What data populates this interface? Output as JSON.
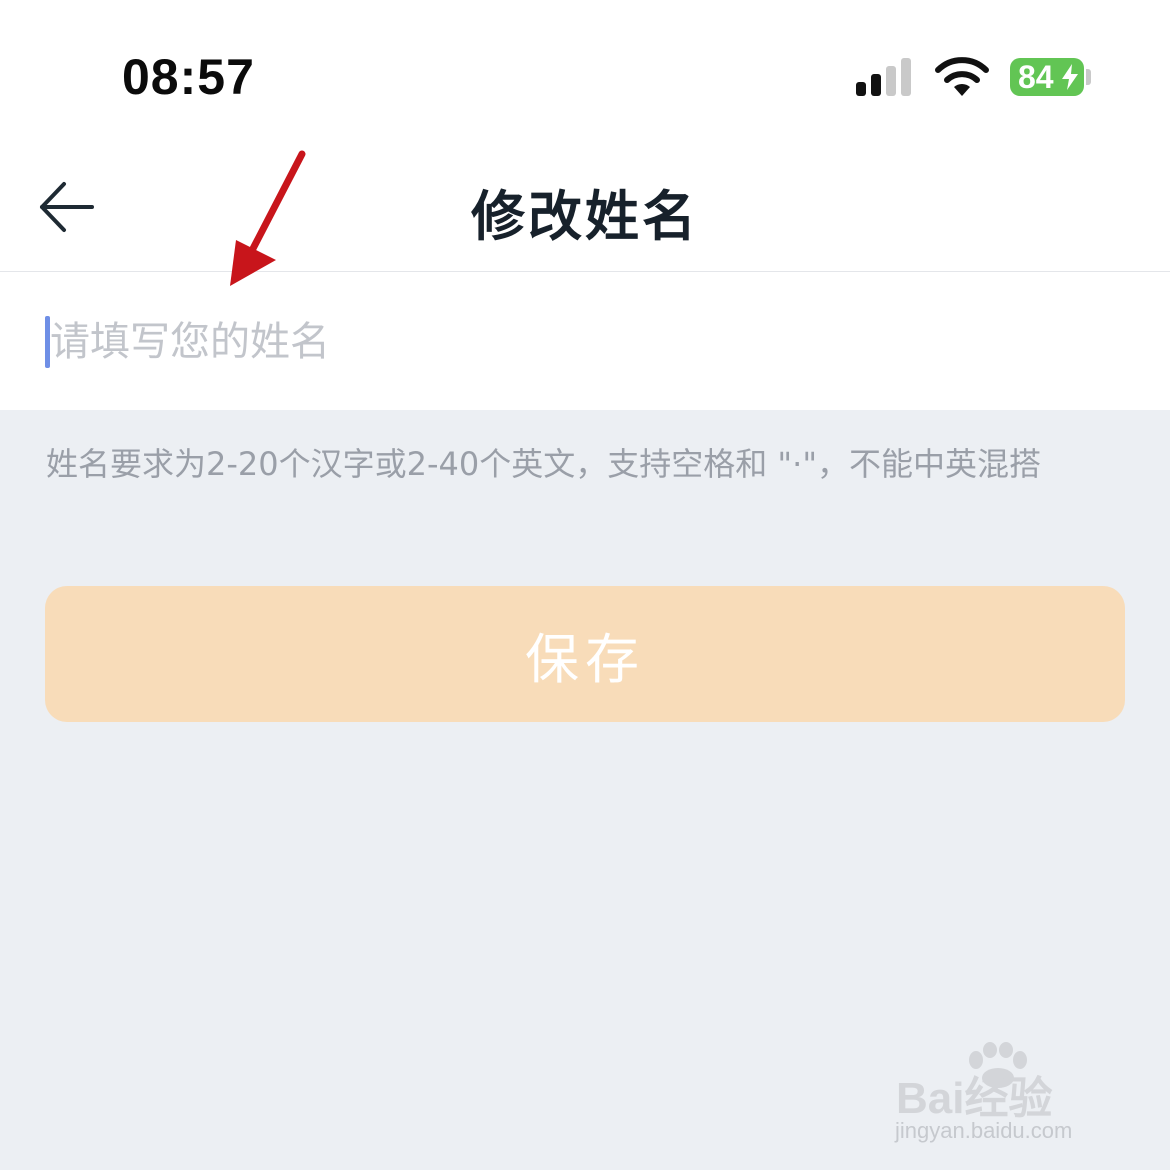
{
  "status_bar": {
    "time": "08:57",
    "battery": "84",
    "battery_color": "#62c554"
  },
  "nav": {
    "back_icon": "arrow-left-icon",
    "title": "修改姓名"
  },
  "form": {
    "name_value": "",
    "name_placeholder": "请填写您的姓名",
    "hint": "姓名要求为2-20个汉字或2-40个英文，支持空格和 \"·\"，不能中英混搭"
  },
  "actions": {
    "save_label": "保存",
    "save_color": "#f8dcb9"
  },
  "annotation": {
    "icon": "red-arrow-icon",
    "color": "#c8151b"
  },
  "watermark": {
    "brand": "Bai经验",
    "url": "jingyan.baidu.com"
  }
}
